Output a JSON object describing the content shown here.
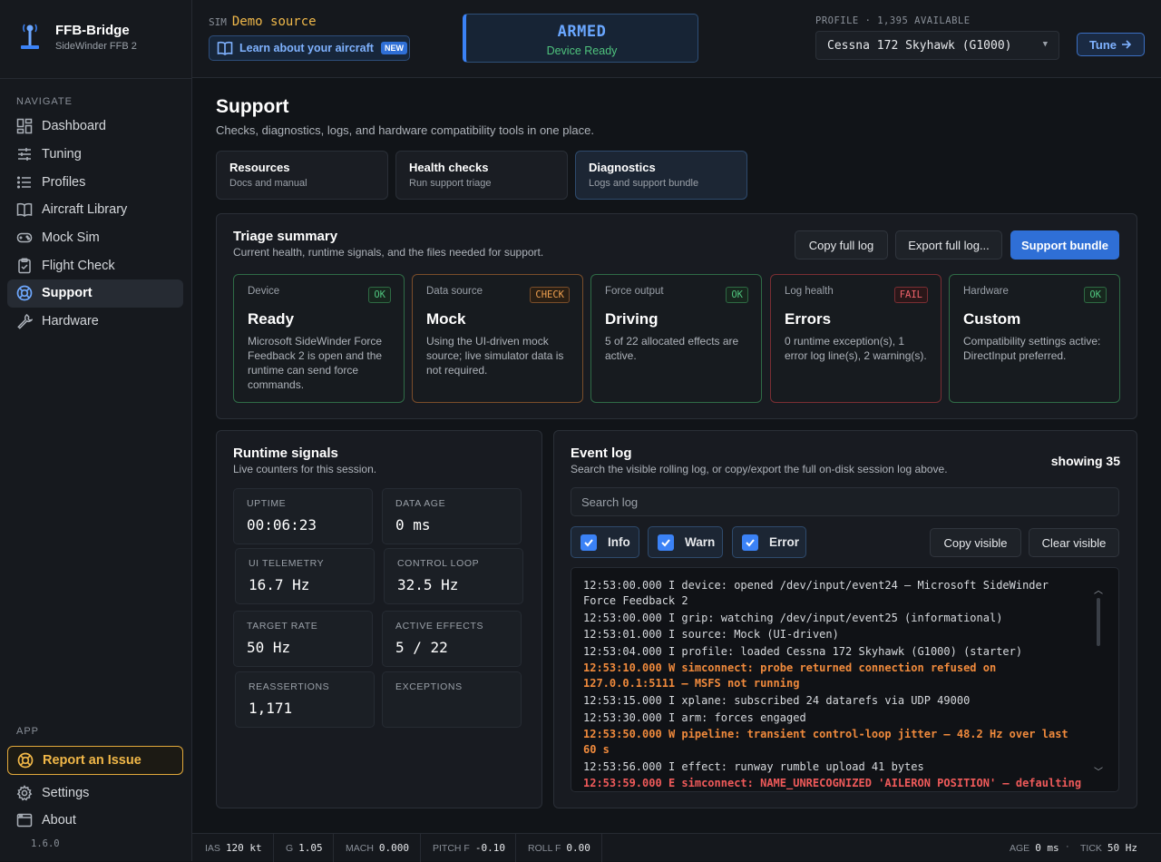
{
  "brand": {
    "title": "FFB-Bridge",
    "subtitle": "SideWinder FFB 2"
  },
  "sidebar": {
    "navigate_label": "NAVIGATE",
    "items": [
      {
        "label": "Dashboard",
        "icon": "dashboard-icon"
      },
      {
        "label": "Tuning",
        "icon": "sliders-icon"
      },
      {
        "label": "Profiles",
        "icon": "list-icon"
      },
      {
        "label": "Aircraft Library",
        "icon": "book-icon"
      },
      {
        "label": "Mock Sim",
        "icon": "gamepad-icon"
      },
      {
        "label": "Flight Check",
        "icon": "clipboard-check-icon"
      },
      {
        "label": "Support",
        "icon": "lifebuoy-icon",
        "active": true
      },
      {
        "label": "Hardware",
        "icon": "wrench-icon"
      }
    ],
    "app_label": "APP",
    "report_label": "Report an Issue",
    "settings_label": "Settings",
    "about_label": "About",
    "version": "1.6.0"
  },
  "topbar": {
    "sim_label": "SIM",
    "sim_value": "Demo source",
    "learn_label": "Learn about your aircraft",
    "new_badge": "NEW",
    "armed_title": "ARMED",
    "armed_sub": "Device Ready",
    "profile_label": "PROFILE · 1,395 AVAILABLE",
    "profile_value": "Cessna 172 Skyhawk (G1000)",
    "tune_label": "Tune"
  },
  "page": {
    "title": "Support",
    "subtitle": "Checks, diagnostics, logs, and hardware compatibility tools in one place.",
    "tabs": [
      {
        "title": "Resources",
        "sub": "Docs and manual"
      },
      {
        "title": "Health checks",
        "sub": "Run support triage"
      },
      {
        "title": "Diagnostics",
        "sub": "Logs and support bundle",
        "active": true
      }
    ]
  },
  "triage": {
    "title": "Triage summary",
    "subtitle": "Current health, runtime signals, and the files needed for support.",
    "copy_log": "Copy full log",
    "export_log": "Export full log...",
    "bundle": "Support bundle",
    "cards": [
      {
        "key": "Device",
        "status": "OK",
        "value": "Ready",
        "desc": "Microsoft SideWinder Force Feedback 2 is open and the runtime can send force commands."
      },
      {
        "key": "Data source",
        "status": "CHECK",
        "value": "Mock",
        "desc": "Using the UI-driven mock source; live simulator data is not required."
      },
      {
        "key": "Force output",
        "status": "OK",
        "value": "Driving",
        "desc": "5 of 22 allocated effects are active."
      },
      {
        "key": "Log health",
        "status": "FAIL",
        "value": "Errors",
        "desc": "0 runtime exception(s), 1 error log line(s), 2 warning(s)."
      },
      {
        "key": "Hardware",
        "status": "OK",
        "value": "Custom",
        "desc": "Compatibility settings active: DirectInput preferred."
      }
    ],
    "colors": {
      "ok": "#4fc37d",
      "check": "#f0a050",
      "fail": "#f0626b"
    }
  },
  "signals": {
    "title": "Runtime signals",
    "subtitle": "Live counters for this session.",
    "stats": [
      {
        "key": "UPTIME",
        "value": "00:06:23"
      },
      {
        "key": "DATA AGE",
        "value": "0 ms"
      },
      {
        "key": "UI TELEMETRY",
        "value": "16.7 Hz"
      },
      {
        "key": "CONTROL LOOP",
        "value": "32.5 Hz"
      },
      {
        "key": "TARGET RATE",
        "value": "50 Hz"
      },
      {
        "key": "ACTIVE EFFECTS",
        "value": "5 / 22"
      },
      {
        "key": "REASSERTIONS",
        "value": "1,171"
      },
      {
        "key": "EXCEPTIONS",
        "value": ""
      }
    ]
  },
  "eventlog": {
    "title": "Event log",
    "subtitle": "Search the visible rolling log, or copy/export the full on-disk session log above.",
    "showing": "showing 35",
    "search_placeholder": "Search log",
    "filters": [
      {
        "label": "Info",
        "checked": true
      },
      {
        "label": "Warn",
        "checked": true
      },
      {
        "label": "Error",
        "checked": true
      }
    ],
    "copy_visible": "Copy visible",
    "clear_visible": "Clear visible",
    "lines": [
      {
        "time": "12:53:00.000",
        "level": "I",
        "msg": "device: opened /dev/input/event24 — Microsoft SideWinder Force Feedback 2"
      },
      {
        "time": "12:53:00.000",
        "level": "I",
        "msg": "grip: watching /dev/input/event25 (informational)"
      },
      {
        "time": "12:53:01.000",
        "level": "I",
        "msg": "source: Mock (UI-driven)"
      },
      {
        "time": "12:53:04.000",
        "level": "I",
        "msg": "profile: loaded Cessna 172 Skyhawk (G1000) (starter)"
      },
      {
        "time": "12:53:10.000",
        "level": "W",
        "msg": "simconnect: probe returned connection refused on 127.0.0.1:5111 — MSFS not running"
      },
      {
        "time": "12:53:15.000",
        "level": "I",
        "msg": "xplane: subscribed 24 datarefs via UDP 49000"
      },
      {
        "time": "12:53:30.000",
        "level": "I",
        "msg": "arm: forces engaged"
      },
      {
        "time": "12:53:50.000",
        "level": "W",
        "msg": "pipeline: transient control-loop jitter — 48.2 Hz over last 60 s"
      },
      {
        "time": "12:53:56.000",
        "level": "I",
        "msg": "effect: runway rumble upload 41 bytes"
      },
      {
        "time": "12:53:59.000",
        "level": "E",
        "msg": "simconnect: NAME_UNRECOGNIZED 'AILERON POSITION' — defaulting"
      }
    ]
  },
  "statusbar": {
    "items": [
      {
        "key": "IAS",
        "value": "120 kt"
      },
      {
        "key": "G",
        "value": "1.05"
      },
      {
        "key": "MACH",
        "value": "0.000"
      },
      {
        "key": "PITCH F",
        "value": "-0.10"
      },
      {
        "key": "ROLL F",
        "value": "0.00"
      }
    ],
    "age_key": "AGE",
    "age_value": "0 ms",
    "tick_key": "TICK",
    "tick_value": "50 Hz"
  }
}
